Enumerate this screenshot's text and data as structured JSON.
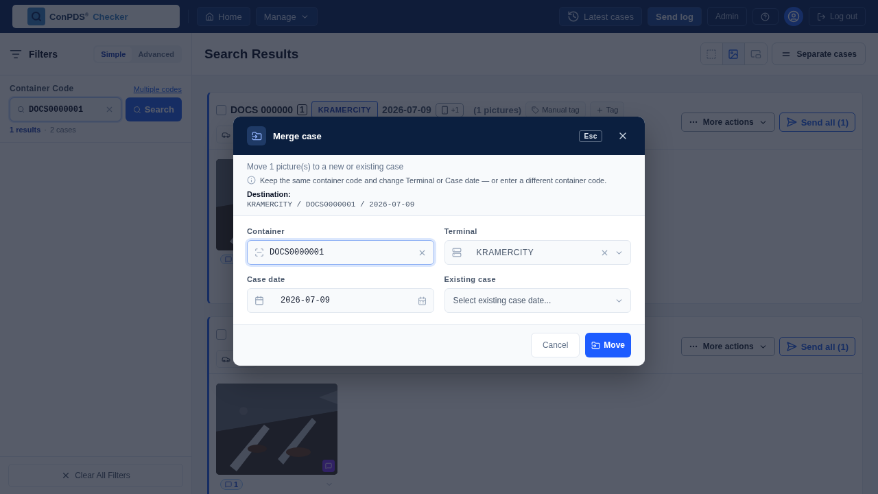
{
  "topbar": {
    "logo": {
      "brand": "ConPDS$^{®}$",
      "suffix": "Checker"
    },
    "nav": [
      {
        "kind": "home",
        "label": "Home"
      },
      {
        "kind": "menu",
        "label": "Manage"
      }
    ],
    "actions": [
      {
        "kind": "history",
        "label": "Latest cases"
      },
      {
        "kind": "filled",
        "label": "Send log"
      },
      {
        "kind": "plain",
        "label": "Admin"
      },
      {
        "kind": "help"
      },
      {
        "kind": "avatar"
      },
      {
        "kind": "logout",
        "label": "Log out"
      }
    ]
  },
  "sidebar": {
    "title": "Filters",
    "modes": [
      {
        "label": "Simple",
        "selected": true
      },
      {
        "label": "Advanced",
        "selected": false
      }
    ],
    "field_label": "Container Code",
    "link": "Multiple codes",
    "search": {
      "value": "DOCS0000001"
    },
    "search_button": "Search",
    "summary": {
      "results": "1 results",
      "separator": "·",
      "cases": "2 cases"
    },
    "clear_button": "Clear All Filters"
  },
  "main": {
    "title": "Search Results",
    "views": [
      {
        "kind": "compact",
        "selected": false
      },
      {
        "kind": "large",
        "selected": true
      },
      {
        "kind": "split",
        "selected": false
      }
    ],
    "separate_button": "Separate cases",
    "cases": [
      {
        "checked": false,
        "title": "DOCS 000000",
        "count": "1",
        "terminal": "KRAMERCITY",
        "date": "2026-07-09",
        "device": "+1",
        "pictures": "(1 pictures)",
        "tags": [
          {
            "kind": "manual",
            "label": "Manual tag"
          },
          {
            "kind": "add",
            "label": "Tag"
          }
        ],
        "more": "More actions",
        "send": "Send all (1)",
        "photos": [
          {
            "kind": "picture"
          }
        ]
      },
      {
        "checked": false,
        "more": "More actions",
        "send": "Send all (1)",
        "photos": [
          {
            "kind": "picture",
            "comments": "1",
            "flagged": true,
            "menu": true
          }
        ]
      }
    ]
  },
  "modal": {
    "title": "Merge case",
    "esc": "Esc",
    "description": "Move 1 picture(s) to a new or existing case",
    "note": "Keep the same container code and change Terminal or Case date — or enter a different container code.",
    "destination_label": "Destination:",
    "destination": "KRAMERCITY / DOCS0000001 / 2026-07-09",
    "fields": [
      {
        "kind": "code",
        "label": "Container",
        "value": "DOCS0000001",
        "focused": true
      },
      {
        "kind": "terminal",
        "label": "Terminal",
        "value": "KRAMERCITY",
        "focused": false
      },
      {
        "kind": "date",
        "label": "Case date",
        "value": "2026-07-09",
        "focused": false
      },
      {
        "kind": "case",
        "label": "Existing case",
        "placeholder": "Select existing case date...",
        "focused": false
      }
    ],
    "buttons": [
      {
        "kind": "secondary",
        "label": "Cancel"
      },
      {
        "kind": "primary",
        "label": "Move"
      }
    ]
  }
}
